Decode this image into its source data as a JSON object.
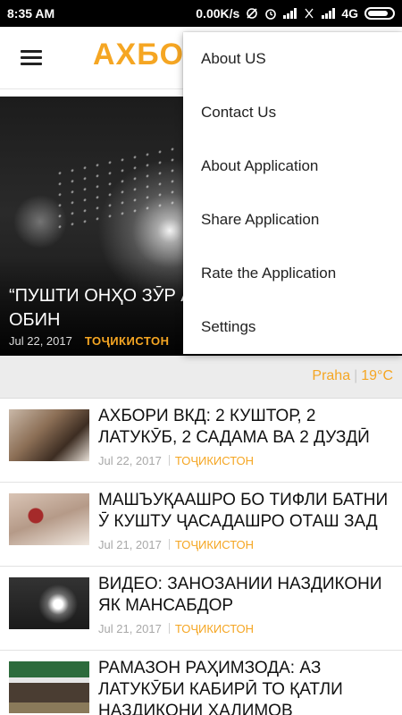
{
  "status_bar": {
    "time": "8:35 AM",
    "speed": "0.00K/s",
    "network": "4G"
  },
  "app_bar": {
    "brand": "АХБО"
  },
  "menu": {
    "items": [
      "About US",
      "Contact Us",
      "About Application",
      "Share Application",
      "Rate the Application",
      "Settings"
    ]
  },
  "hero": {
    "title": "“ПУШТИ ОНҲО ЗӮР АС ЗАНОЗАНӢ ДАР ОБИН",
    "date": "Jul 22, 2017",
    "category": "ТОҶИКИСТОН"
  },
  "weather": {
    "city": "Praha",
    "temp": "19°C"
  },
  "articles": [
    {
      "title": "АХБОРИ ВКД: 2 КУШТОР, 2 ЛАТУКӮБ, 2 САДАМА ВА 2 ДУЗДӢ",
      "date": "Jul 22, 2017",
      "category": "ТОҶИКИСТОН"
    },
    {
      "title": "МАШЪУҚААШРО БО ТИФЛИ БАТНИ Ӯ КУШТУ ҶАСАДАШРО ОТАШ ЗАД",
      "date": "Jul 21, 2017",
      "category": "ТОҶИКИСТОН"
    },
    {
      "title": "ВИДЕО: ЗАНОЗАНИИ НАЗДИКОНИ ЯК МАНСАБДОР",
      "date": "Jul 21, 2017",
      "category": "ТОҶИКИСТОН"
    },
    {
      "title": "РАМАЗОН РАҲИМЗОДА: АЗ ЛАТУКӮБИ КАБИРӢ ТО ҚАТЛИ НАЗДИКОНИ ҲАЛИМОВ",
      "date": "",
      "category": ""
    }
  ],
  "colors": {
    "accent": "#f5a623",
    "status_bar": "#000000",
    "meta_gray": "#a8a8a8"
  }
}
